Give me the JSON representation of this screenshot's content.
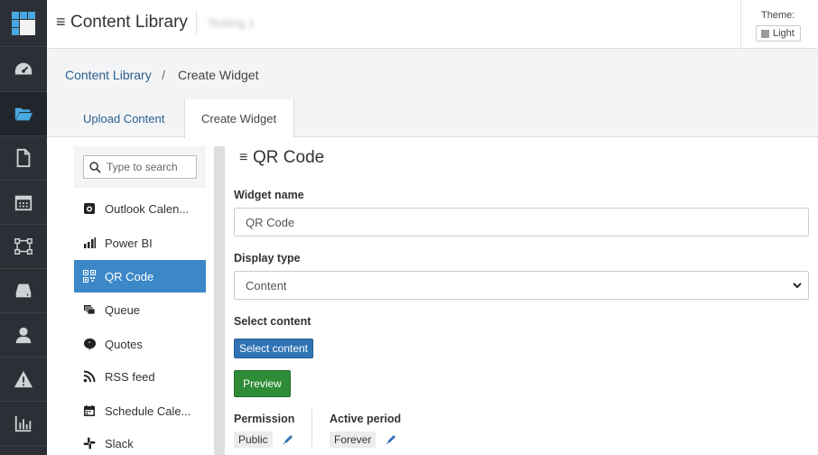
{
  "header": {
    "title": "Content Library",
    "workspace": "Testing 1",
    "theme_label": "Theme:",
    "theme_value": "Light"
  },
  "breadcrumb": {
    "root": "Content Library",
    "separator": "/",
    "current": "Create Widget"
  },
  "tabs": [
    {
      "label": "Upload Content",
      "active": false
    },
    {
      "label": "Create Widget",
      "active": true
    }
  ],
  "widget_list": {
    "search_placeholder": "Type to search",
    "items": [
      {
        "label": "Outlook Calen...",
        "icon": "outlook-calendar-icon",
        "selected": false
      },
      {
        "label": "Power BI",
        "icon": "power-bi-icon",
        "selected": false
      },
      {
        "label": "QR Code",
        "icon": "qr-code-icon",
        "selected": true
      },
      {
        "label": "Queue",
        "icon": "queue-icon",
        "selected": false
      },
      {
        "label": "Quotes",
        "icon": "quotes-icon",
        "selected": false
      },
      {
        "label": "RSS feed",
        "icon": "rss-icon",
        "selected": false
      },
      {
        "label": "Schedule Cale...",
        "icon": "schedule-calendar-icon",
        "selected": false
      },
      {
        "label": "Slack",
        "icon": "slack-icon",
        "selected": false
      }
    ]
  },
  "form": {
    "title": "QR Code",
    "widget_name_label": "Widget name",
    "widget_name_value": "QR Code",
    "display_type_label": "Display type",
    "display_type_value": "Content",
    "select_content_label": "Select content",
    "select_content_button": "Select content",
    "preview_button": "Preview",
    "permission_label": "Permission",
    "permission_value": "Public",
    "active_period_label": "Active period",
    "active_period_value": "Forever"
  },
  "colors": {
    "rail_bg": "#2c3036",
    "logo_tiles": "#4aa8e0",
    "selected_item": "#3b87c8",
    "primary_button": "#2f73b5",
    "preview_button": "#2e8b36",
    "link": "#2b5f8c"
  }
}
